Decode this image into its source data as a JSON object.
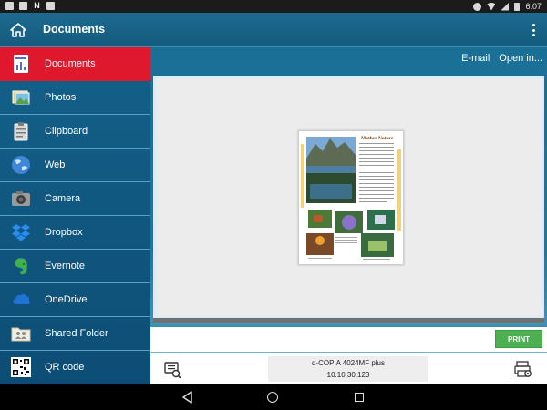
{
  "status_bar": {
    "time": "6:07",
    "left_icons": [
      "dropbox-notification-icon",
      "image-notification-icon",
      "n-notification-icon",
      "news-notification-icon"
    ],
    "right_icons": [
      "do-not-disturb-icon",
      "wifi-icon",
      "signal-icon",
      "battery-icon"
    ]
  },
  "app_bar": {
    "title": "Documents",
    "home_icon": "home-icon",
    "overflow_icon": "overflow-menu-icon"
  },
  "sidebar": {
    "items": [
      {
        "label": "Documents",
        "icon": "documents-icon",
        "active": true
      },
      {
        "label": "Photos",
        "icon": "photos-icon"
      },
      {
        "label": "Clipboard",
        "icon": "clipboard-icon"
      },
      {
        "label": "Web",
        "icon": "web-globe-icon"
      },
      {
        "label": "Camera",
        "icon": "camera-icon"
      },
      {
        "label": "Dropbox",
        "icon": "dropbox-icon"
      },
      {
        "label": "Evernote",
        "icon": "evernote-icon"
      },
      {
        "label": "OneDrive",
        "icon": "onedrive-icon"
      },
      {
        "label": "Shared Folder",
        "icon": "shared-folder-icon"
      },
      {
        "label": "QR code",
        "icon": "qr-code-icon"
      }
    ]
  },
  "main": {
    "actions": {
      "email": "E-mail",
      "open_in": "Open in..."
    },
    "preview": {
      "document_title": "Mother Nature"
    },
    "print_button": "PRINT",
    "printer": {
      "name": "d-COPIA 4024MF plus",
      "ip": "10.10.30.123"
    }
  },
  "nav_bar": {
    "icons": [
      "back-icon",
      "home-circle-icon",
      "recents-icon"
    ]
  },
  "colors": {
    "accent_red": "#e0182d",
    "primary_blue": "#155b7e",
    "print_green": "#4caf50"
  }
}
